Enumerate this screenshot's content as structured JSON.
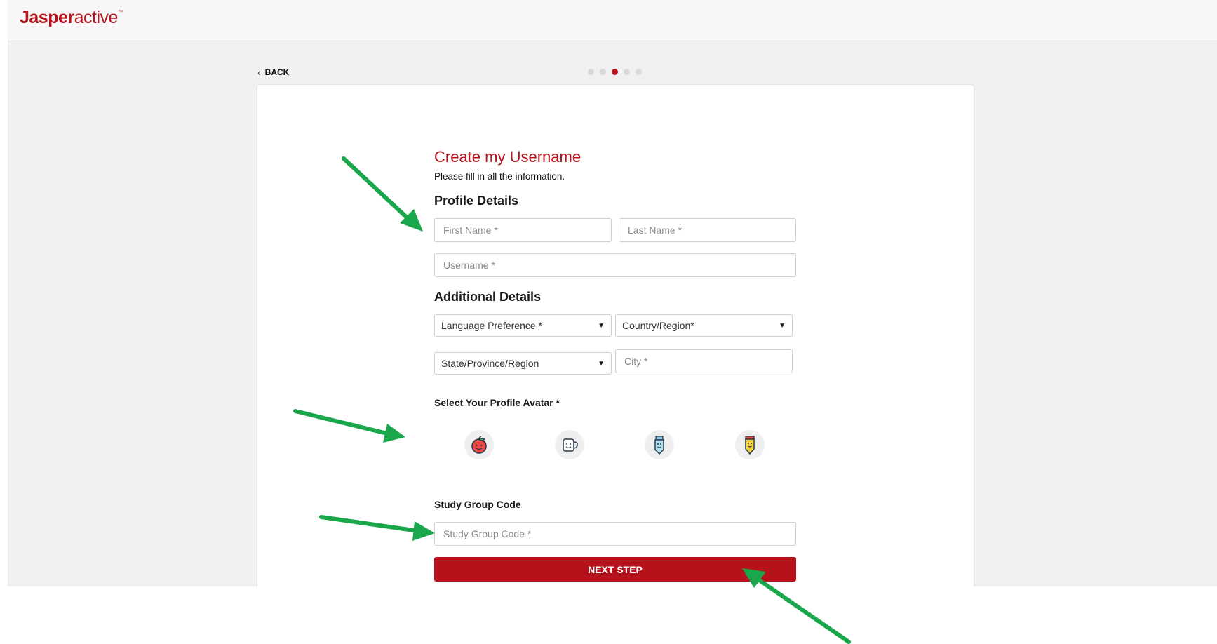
{
  "header": {
    "logo_bold": "Jasper",
    "logo_light": "active",
    "logo_tm": "™"
  },
  "nav": {
    "back_label": "BACK",
    "steps_total": 5,
    "steps_current": 3
  },
  "form": {
    "title": "Create my Username",
    "subtitle": "Please fill in all the information.",
    "profile_section": "Profile Details",
    "first_name_placeholder": "First Name *",
    "last_name_placeholder": "Last Name *",
    "username_placeholder": "Username *",
    "additional_section": "Additional Details",
    "language_select": "Language Preference *",
    "country_select": "Country/Region*",
    "state_select": "State/Province/Region",
    "city_placeholder": "City *",
    "avatar_label": "Select Your Profile Avatar *",
    "avatars": [
      "apple-avatar-icon",
      "mug-avatar-icon",
      "marker-avatar-icon",
      "pencil-avatar-icon"
    ],
    "study_group_label": "Study Group Code",
    "study_group_placeholder": "Study Group Code *",
    "next_button": "NEXT STEP"
  },
  "colors": {
    "brand": "#b5121b",
    "annotation_arrow": "#1aa64a"
  }
}
